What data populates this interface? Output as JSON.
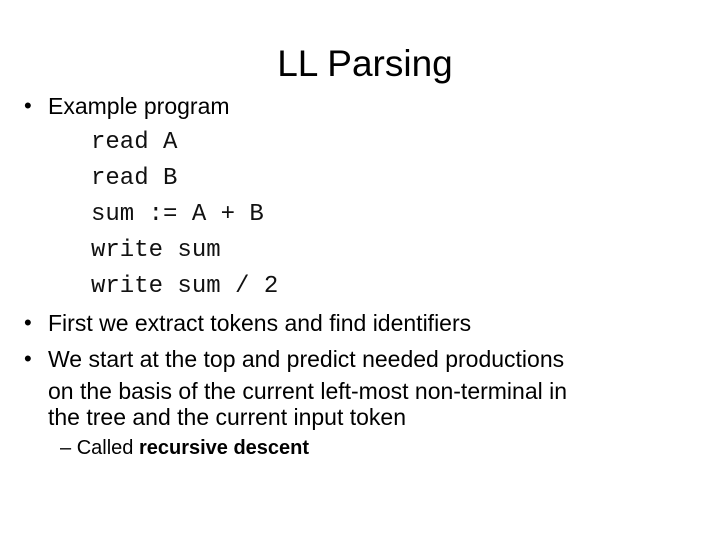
{
  "slide": {
    "title": "LL Parsing",
    "bullets": [
      {
        "marker": "•",
        "text": "Example program"
      },
      {
        "marker": "•",
        "text": "First we extract tokens and find identifiers"
      },
      {
        "marker": "•",
        "lines": [
          "We start at the top and predict needed productions",
          "on the basis of the current left-most non-terminal in",
          "the tree and the current input token"
        ]
      }
    ],
    "code_lines": [
      "read A",
      "read B",
      "sum := A + B",
      "write sum",
      "write sum / 2"
    ],
    "sub_bullet": {
      "marker": "–",
      "prefix": "Called ",
      "emphasis": "recursive descent"
    }
  }
}
